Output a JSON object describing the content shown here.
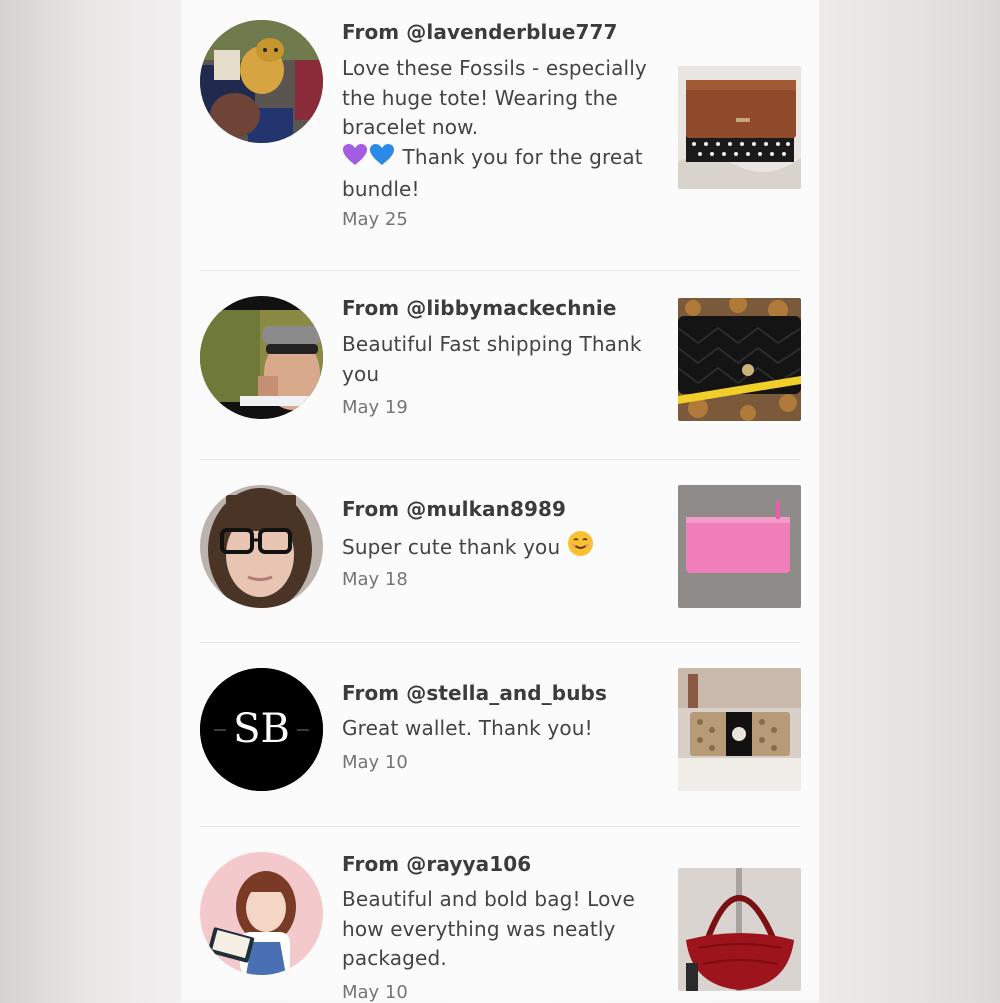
{
  "reviews": [
    {
      "user": "From @lavenderblue777",
      "message": "Love these Fossils - especially the huge tote! Wearing the bracelet now.",
      "message_tail": "Thank you for the great bundle!",
      "emoji": [
        "purple-heart",
        "blue-heart"
      ],
      "date": "May 25"
    },
    {
      "user": "From @libbymackechnie",
      "message": "Beautiful Fast shipping Thank you",
      "date": "May 19"
    },
    {
      "user": "From @mulkan8989",
      "message": "Super cute thank you",
      "emoji": [
        "smiling-face"
      ],
      "date": "May 18"
    },
    {
      "user": "From @stella_and_bubs",
      "message": "Great wallet. Thank you!",
      "date": "May 10",
      "avatar_text": "SB"
    },
    {
      "user": "From @rayya106",
      "message": "Beautiful and bold bag! Love how everything was neatly packaged.",
      "date": "May 10"
    }
  ],
  "colors": {
    "panel": "#fcfbfb",
    "text": "#444444",
    "username": "#3c3c3c",
    "date": "#757575",
    "divider": "#e8e6e6"
  }
}
